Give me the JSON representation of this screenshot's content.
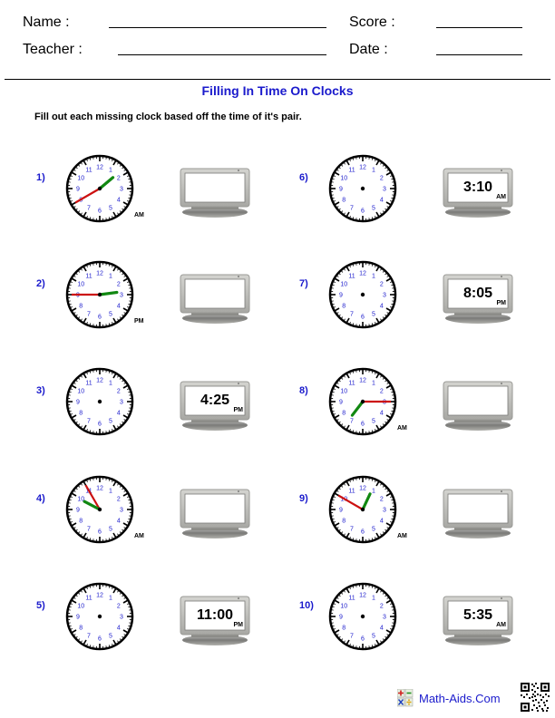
{
  "header": {
    "name_label": "Name :",
    "teacher_label": "Teacher :",
    "score_label": "Score :",
    "date_label": "Date :"
  },
  "title": "Filling In Time On Clocks",
  "instructions": "Fill out each missing clock based off the time of it's pair.",
  "clock_numbers": [
    "12",
    "1",
    "2",
    "3",
    "4",
    "5",
    "6",
    "7",
    "8",
    "9",
    "10",
    "11"
  ],
  "colors": {
    "accent_blue": "#1a1acc",
    "hour_hand": "#118811",
    "minute_hand": "#cc1111"
  },
  "problems": [
    {
      "label": "1)",
      "analog_time": {
        "hour": 1,
        "minute": 40
      },
      "analog_ampm": "AM",
      "digital": "",
      "digital_ampm": ""
    },
    {
      "label": "2)",
      "analog_time": {
        "hour": 2,
        "minute": 45
      },
      "analog_ampm": "PM",
      "digital": "",
      "digital_ampm": ""
    },
    {
      "label": "3)",
      "analog_time": null,
      "analog_ampm": "",
      "digital": "4:25",
      "digital_ampm": "PM"
    },
    {
      "label": "4)",
      "analog_time": {
        "hour": 9,
        "minute": 55
      },
      "analog_ampm": "AM",
      "digital": "",
      "digital_ampm": ""
    },
    {
      "label": "5)",
      "analog_time": null,
      "analog_ampm": "",
      "digital": "11:00",
      "digital_ampm": "PM"
    },
    {
      "label": "6)",
      "analog_time": null,
      "analog_ampm": "",
      "digital": "3:10",
      "digital_ampm": "AM"
    },
    {
      "label": "7)",
      "analog_time": null,
      "analog_ampm": "",
      "digital": "8:05",
      "digital_ampm": "PM"
    },
    {
      "label": "8)",
      "analog_time": {
        "hour": 7,
        "minute": 15
      },
      "analog_ampm": "AM",
      "digital": "",
      "digital_ampm": ""
    },
    {
      "label": "9)",
      "analog_time": {
        "hour": 12,
        "minute": 50
      },
      "analog_ampm": "AM",
      "digital": "",
      "digital_ampm": ""
    },
    {
      "label": "10)",
      "analog_time": null,
      "analog_ampm": "",
      "digital": "5:35",
      "digital_ampm": "AM"
    }
  ],
  "footer": {
    "brand": "Math-Aids.Com",
    "logo_icon": "calculator-icon",
    "qr_icon": "qr-code-icon"
  }
}
